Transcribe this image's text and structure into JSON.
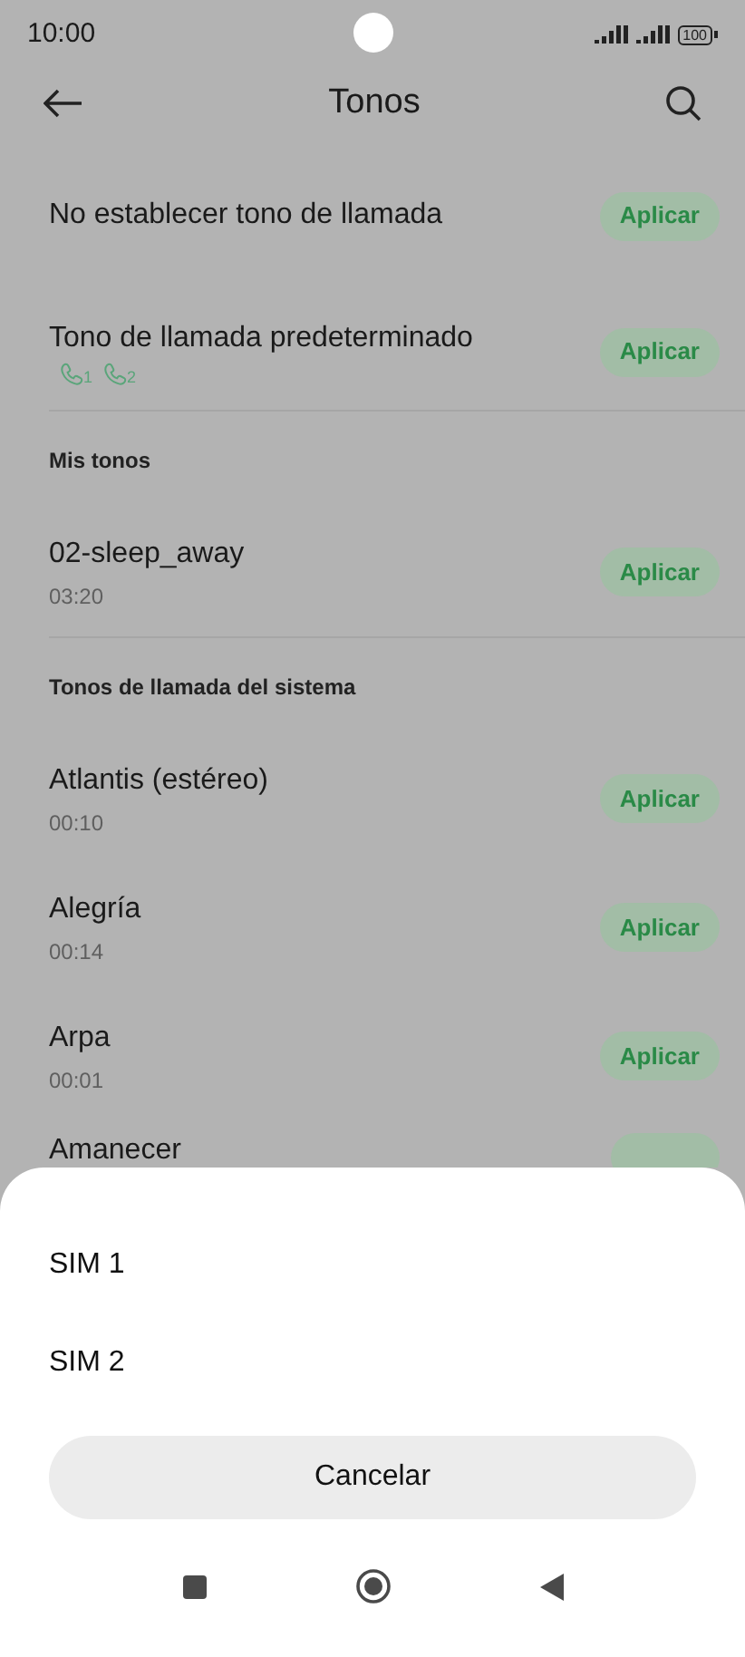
{
  "status_bar": {
    "time": "10:00",
    "battery": "100"
  },
  "header": {
    "title": "Tonos"
  },
  "groups": [
    {
      "items": [
        {
          "title": "No establecer tono de llamada",
          "button": "Aplicar"
        },
        {
          "title": "Tono de llamada predeterminado",
          "sims": [
            "1",
            "2"
          ],
          "button": "Aplicar"
        }
      ]
    },
    {
      "heading": "Mis tonos",
      "items": [
        {
          "title": "02-sleep_away",
          "duration": "03:20",
          "button": "Aplicar"
        }
      ]
    },
    {
      "heading": "Tonos de llamada del sistema",
      "items": [
        {
          "title": "Atlantis (estéreo)",
          "duration": "00:10",
          "button": "Aplicar"
        },
        {
          "title": "Alegría",
          "duration": "00:14",
          "button": "Aplicar"
        },
        {
          "title": "Arpa",
          "duration": "00:01",
          "button": "Aplicar"
        },
        {
          "title": "Amanecer"
        }
      ]
    }
  ],
  "sheet": {
    "options": [
      "SIM 1",
      "SIM 2"
    ],
    "cancel": "Cancelar"
  }
}
